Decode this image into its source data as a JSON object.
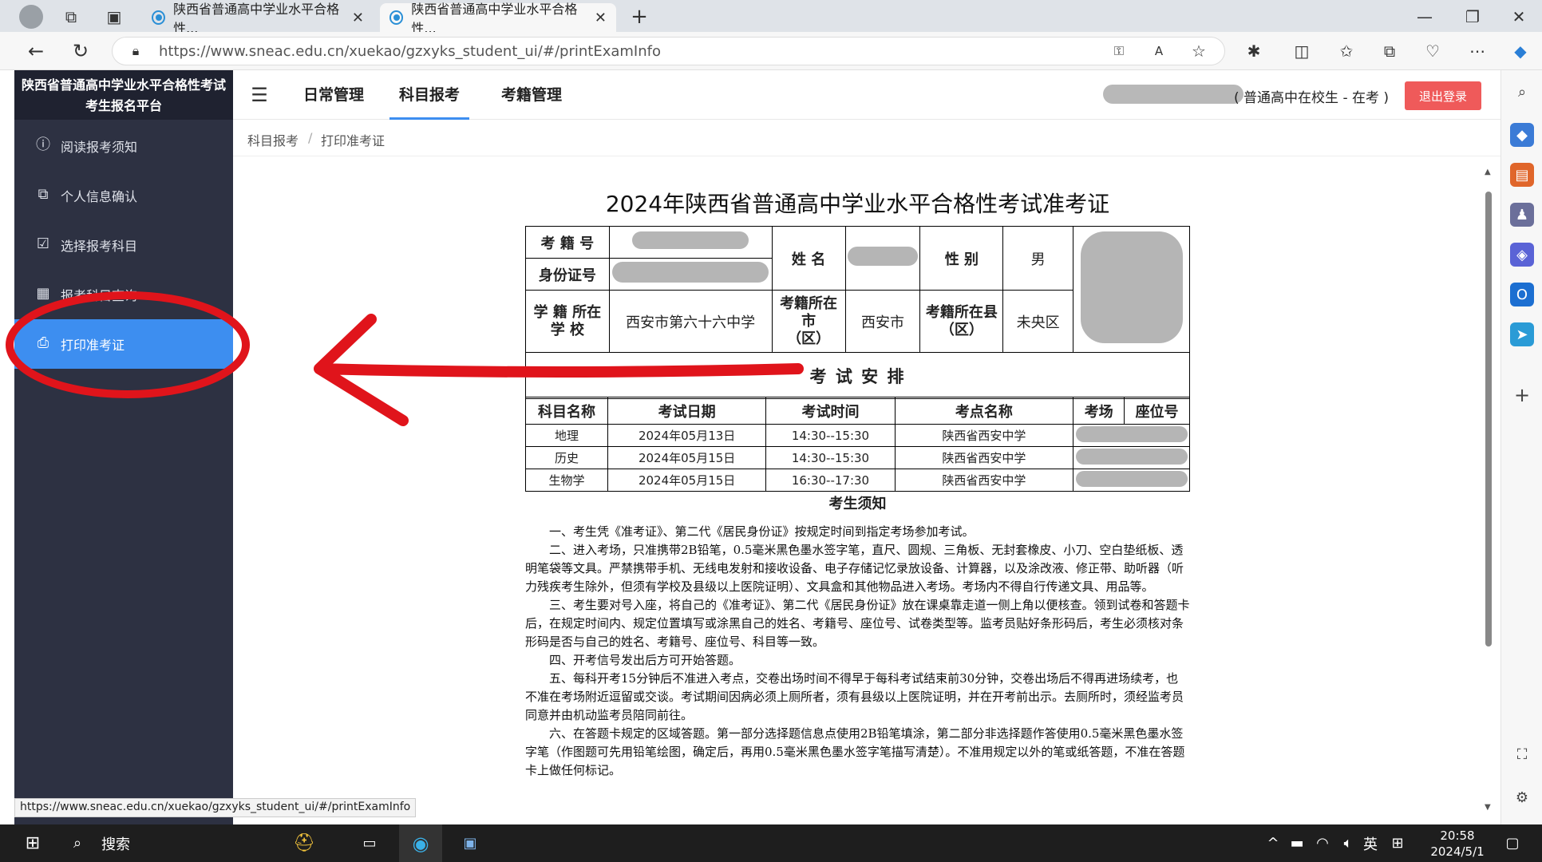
{
  "browser": {
    "tabs": [
      {
        "title": "陕西省普通高中学业水平合格性..."
      },
      {
        "title": "陕西省普通高中学业水平合格性..."
      }
    ],
    "url": "https://www.sneac.edu.cn/xuekao/gzxyks_student_ui/#/printExamInfo",
    "status_url": "https://www.sneac.edu.cn/xuekao/gzxyks_student_ui/#/printExamInfo"
  },
  "app": {
    "title_line1": "陕西省普通高中学业水平合格性考试",
    "title_line2": "考生报名平台",
    "nav": [
      {
        "label": "阅读报考须知"
      },
      {
        "label": "个人信息确认"
      },
      {
        "label": "选择报考科目"
      },
      {
        "label": "报考科目查询"
      },
      {
        "label": "打印准考证"
      }
    ],
    "menu": [
      "日常管理",
      "科目报考",
      "考籍管理"
    ],
    "user_role": "( 普通高中在校生 - 在考 )",
    "logout": "退出登录",
    "breadcrumb": [
      "科目报考",
      "/",
      "打印准考证"
    ]
  },
  "card": {
    "title": "2024年陕西省普通高中学业水平合格性考试准考证",
    "label_kaoji": "考 籍 号",
    "label_idcard": "身份证号",
    "label_name": "姓 名",
    "label_gender": "性 别",
    "gender": "男",
    "label_school": "学 籍 所在\n学 校",
    "school": "西安市第六十六中学",
    "label_city": "考籍所在市\n（区）",
    "city": "西安市",
    "label_county": "考籍所在县\n（区）",
    "county": "未央区",
    "arrange_title": "考 试 安 排",
    "sched_headers": [
      "科目名称",
      "考试日期",
      "考试时间",
      "考点名称",
      "考场",
      "座位号"
    ],
    "sched_rows": [
      {
        "subject": "地理",
        "date": "2024年05月13日",
        "time": "14:30--15:30",
        "site": "陕西省西安中学"
      },
      {
        "subject": "历史",
        "date": "2024年05月15日",
        "time": "14:30--15:30",
        "site": "陕西省西安中学"
      },
      {
        "subject": "生物学",
        "date": "2024年05月15日",
        "time": "16:30--17:30",
        "site": "陕西省西安中学"
      }
    ],
    "notice_title": "考生须知",
    "notice": [
      "一、考生凭《准考证》、第二代《居民身份证》按规定时间到指定考场参加考试。",
      "二、进入考场，只准携带2B铅笔，0.5毫米黑色墨水签字笔，直尺、圆规、三角板、无封套橡皮、小刀、空白垫纸板、透明笔袋等文具。严禁携带手机、无线电发射和接收设备、电子存储记忆录放设备、计算器，以及涂改液、修正带、助听器（听力残疾考生除外，但须有学校及县级以上医院证明）、文具盒和其他物品进入考场。考场内不得自行传递文具、用品等。",
      "三、考生要对号入座，将自己的《准考证》、第二代《居民身份证》放在课桌靠走道一侧上角以便核查。领到试卷和答题卡后，在规定时间内、规定位置填写或涂黑自己的姓名、考籍号、座位号、试卷类型等。监考员贴好条形码后，考生必须核对条形码是否与自己的姓名、考籍号、座位号、科目等一致。",
      "四、开考信号发出后方可开始答题。",
      "五、每科开考15分钟后不准进入考点，交卷出场时间不得早于每科考试结束前30分钟，交卷出场后不得再进场续考，也不准在考场附近逗留或交谈。考试期间因病必须上厕所者，须有县级以上医院证明，并在开考前出示。去厕所时，须经监考员同意并由机动监考员陪同前往。",
      "六、在答题卡规定的区域答题。第一部分选择题信息点使用2B铅笔填涂，第二部分非选择题作答使用0.5毫米黑色墨水签字笔（作图题可先用铅笔绘图，确定后，再用0.5毫米黑色墨水签字笔描写清楚）。不准用规定以外的笔或纸答题，不准在答题卡上做任何标记。"
    ]
  },
  "taskbar": {
    "search": "搜索",
    "time": "20:58",
    "date": "2024/5/1",
    "ime": "英"
  }
}
